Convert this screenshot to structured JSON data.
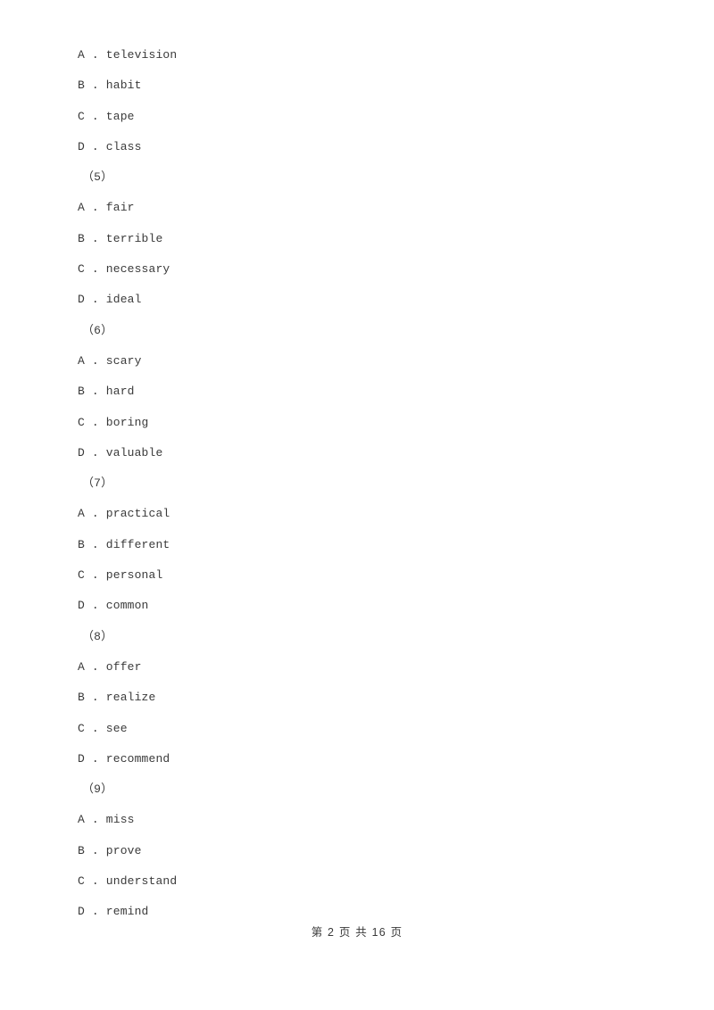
{
  "document": {
    "background_color": "#ffffff",
    "text_color": "#3a3a3a"
  },
  "body_lines": [
    {
      "kind": "option",
      "text": "A . television"
    },
    {
      "kind": "option",
      "text": "B . habit"
    },
    {
      "kind": "option",
      "text": "C . tape"
    },
    {
      "kind": "option",
      "text": "D . class"
    },
    {
      "kind": "qnum",
      "text": "（5）"
    },
    {
      "kind": "option",
      "text": "A . fair"
    },
    {
      "kind": "option",
      "text": "B . terrible"
    },
    {
      "kind": "option",
      "text": "C . necessary"
    },
    {
      "kind": "option",
      "text": "D . ideal"
    },
    {
      "kind": "qnum",
      "text": "（6）"
    },
    {
      "kind": "option",
      "text": "A . scary"
    },
    {
      "kind": "option",
      "text": "B . hard"
    },
    {
      "kind": "option",
      "text": "C . boring"
    },
    {
      "kind": "option",
      "text": "D . valuable"
    },
    {
      "kind": "qnum",
      "text": "（7）"
    },
    {
      "kind": "option",
      "text": "A . practical"
    },
    {
      "kind": "option",
      "text": "B . different"
    },
    {
      "kind": "option",
      "text": "C . personal"
    },
    {
      "kind": "option",
      "text": "D . common"
    },
    {
      "kind": "qnum",
      "text": "（8）"
    },
    {
      "kind": "option",
      "text": "A . offer"
    },
    {
      "kind": "option",
      "text": "B . realize"
    },
    {
      "kind": "option",
      "text": "C . see"
    },
    {
      "kind": "option",
      "text": "D . recommend"
    },
    {
      "kind": "qnum",
      "text": "（9）"
    },
    {
      "kind": "option",
      "text": "A . miss"
    },
    {
      "kind": "option",
      "text": "B . prove"
    },
    {
      "kind": "option",
      "text": "C . understand"
    },
    {
      "kind": "option",
      "text": "D . remind"
    }
  ],
  "footer": {
    "text": "第 2 页 共 16 页",
    "current_page": "2",
    "total_pages": "16"
  }
}
